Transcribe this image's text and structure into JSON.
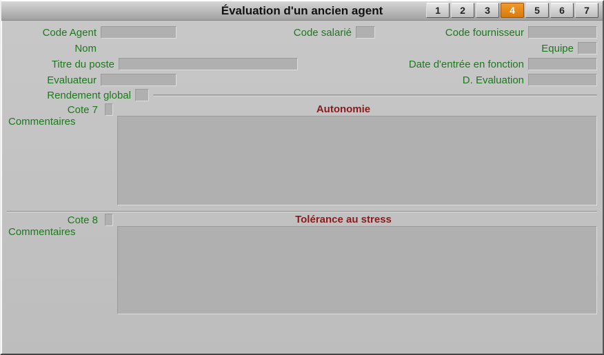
{
  "title": "Évaluation d'un ancien agent",
  "tabs": [
    "1",
    "2",
    "3",
    "4",
    "5",
    "6",
    "7"
  ],
  "active_tab_index": 3,
  "fields": {
    "code_agent": {
      "label": "Code Agent",
      "value": ""
    },
    "code_salarie": {
      "label": "Code salarié",
      "value": ""
    },
    "code_fournisseur": {
      "label": "Code fournisseur",
      "value": ""
    },
    "nom": {
      "label": "Nom",
      "value": ""
    },
    "equipe": {
      "label": "Equipe",
      "value": ""
    },
    "titre_poste": {
      "label": "Titre du poste",
      "value": ""
    },
    "date_entree": {
      "label": "Date d'entrée en fonction",
      "value": ""
    },
    "evaluateur": {
      "label": "Evaluateur",
      "value": ""
    },
    "d_evaluation": {
      "label": "D. Evaluation",
      "value": ""
    },
    "rendement_global": {
      "label": "Rendement global",
      "value": ""
    }
  },
  "sections": {
    "s7": {
      "cote_label": "Cote 7",
      "cote_value": "",
      "title": "Autonomie",
      "comments_label": "Commentaires",
      "comments_value": ""
    },
    "s8": {
      "cote_label": "Cote 8",
      "cote_value": "",
      "title": "Tolérance au stress",
      "comments_label": "Commentaires",
      "comments_value": ""
    }
  }
}
